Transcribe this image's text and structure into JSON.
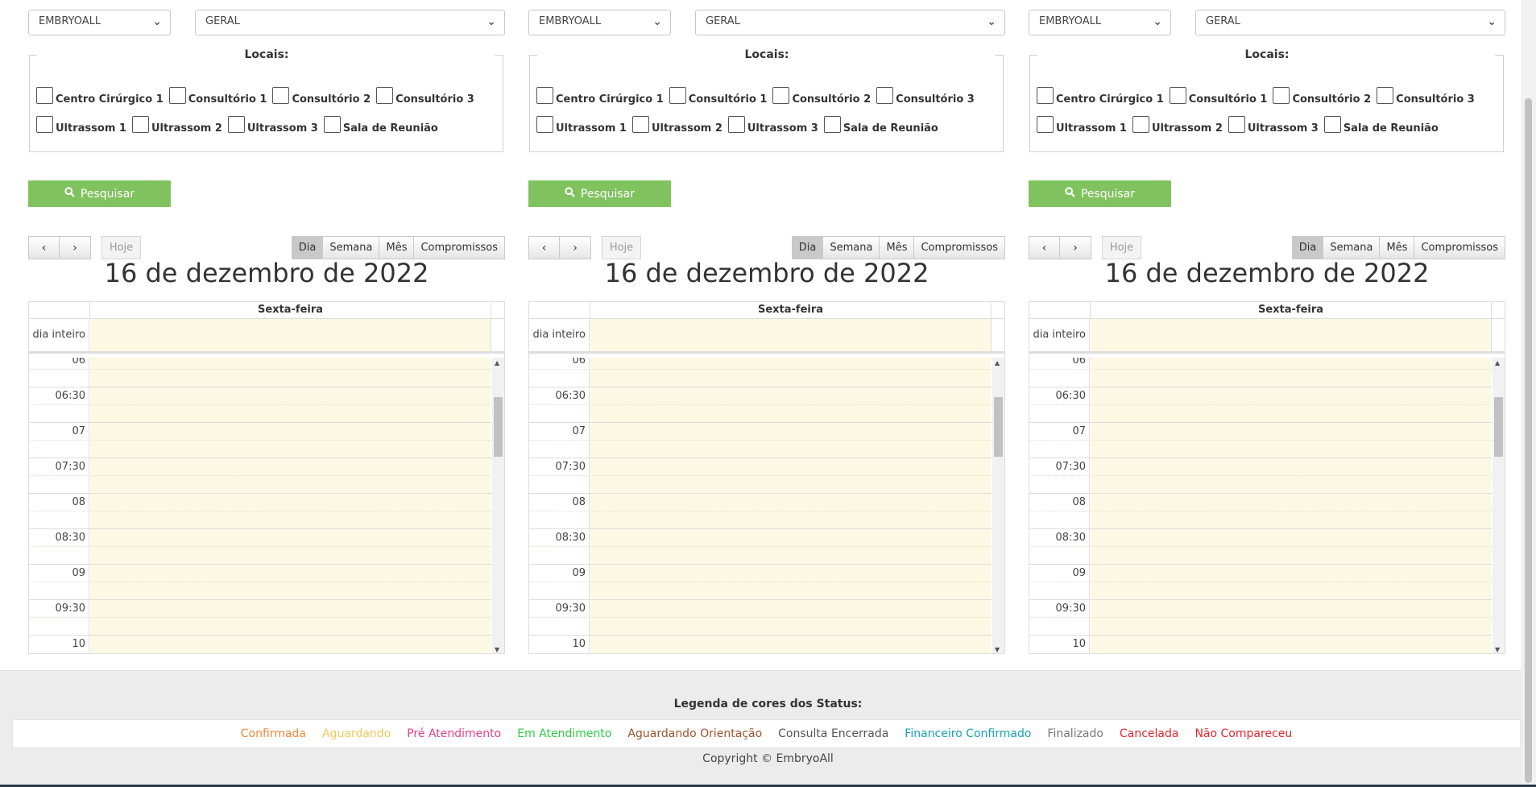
{
  "columns": [
    {
      "clinic_select": "EMBRYOALL",
      "agenda_select": "GERAL",
      "locais_title": "Locais:",
      "locais_row1": [
        "Centro Cirúrgico 1",
        "Consultório 1",
        "Consultório 2",
        "Consultório 3"
      ],
      "locais_row2": [
        "Ultrassom 1",
        "Ultrassom 2",
        "Ultrassom 3",
        "Sala de Reunião"
      ],
      "search_label": "Pesquisar",
      "today_label": "Hoje",
      "views": [
        "Dia",
        "Semana",
        "Mês",
        "Compromissos"
      ],
      "date_title": "16 de dezembro de 2022",
      "day_header": "Sexta-feira",
      "allday_label": "dia inteiro"
    },
    {
      "clinic_select": "EMBRYOALL",
      "agenda_select": "GERAL",
      "locais_title": "Locais:",
      "locais_row1": [
        "Centro Cirúrgico 1",
        "Consultório 1",
        "Consultório 2",
        "Consultório 3"
      ],
      "locais_row2": [
        "Ultrassom 1",
        "Ultrassom 2",
        "Ultrassom 3",
        "Sala de Reunião"
      ],
      "search_label": "Pesquisar",
      "today_label": "Hoje",
      "views": [
        "Dia",
        "Semana",
        "Mês",
        "Compromissos"
      ],
      "date_title": "16 de dezembro de 2022",
      "day_header": "Sexta-feira",
      "allday_label": "dia inteiro"
    },
    {
      "clinic_select": "EMBRYOALL",
      "agenda_select": "GERAL",
      "locais_title": "Locais:",
      "locais_row1": [
        "Centro Cirúrgico 1",
        "Consultório 1",
        "Consultório 2",
        "Consultório 3"
      ],
      "locais_row2": [
        "Ultrassom 1",
        "Ultrassom 2",
        "Ultrassom 3",
        "Sala de Reunião"
      ],
      "search_label": "Pesquisar",
      "today_label": "Hoje",
      "views": [
        "Dia",
        "Semana",
        "Mês",
        "Compromissos"
      ],
      "date_title": "16 de dezembro de 2022",
      "day_header": "Sexta-feira",
      "allday_label": "dia inteiro"
    }
  ],
  "time_slots": [
    "06",
    "",
    "06:30",
    "",
    "07",
    "",
    "07:30",
    "",
    "08",
    "",
    "08:30",
    "",
    "09",
    "",
    "09:30",
    "",
    "10"
  ],
  "active_view": "Dia",
  "icons": {
    "search": "search-icon",
    "prev": "chevron-left-icon",
    "next": "chevron-right-icon",
    "select": "chevron-down-icon"
  },
  "footer": {
    "legend_title": "Legenda de cores dos Status:",
    "statuses": [
      {
        "label": "Confirmada",
        "color": "#f0883a"
      },
      {
        "label": "Aguardando",
        "color": "#f6c75a"
      },
      {
        "label": "Pré Atendimento",
        "color": "#e83e8c"
      },
      {
        "label": "Em Atendimento",
        "color": "#2ecc40"
      },
      {
        "label": "Aguardando Orientação",
        "color": "#a0522d"
      },
      {
        "label": "Consulta Encerrada",
        "color": "#555555"
      },
      {
        "label": "Financeiro Confirmado",
        "color": "#17a2b8"
      },
      {
        "label": "Finalizado",
        "color": "#777777"
      },
      {
        "label": "Cancelada",
        "color": "#e3262e"
      },
      {
        "label": "Não Compareceu",
        "color": "#e3262e"
      }
    ],
    "copyright": "Copyright © EmbryoAll"
  }
}
